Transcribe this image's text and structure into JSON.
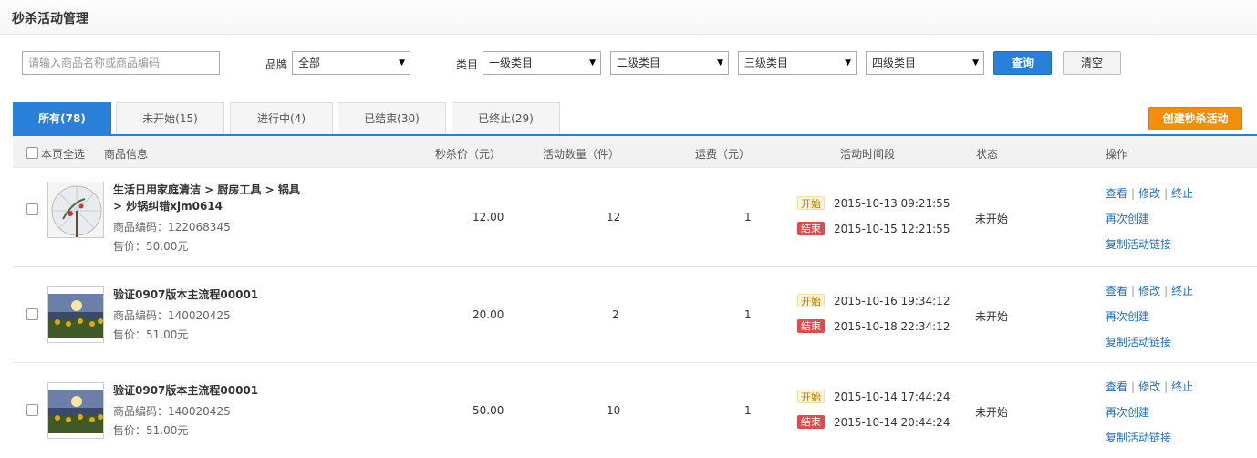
{
  "header": {
    "title": "秒杀活动管理"
  },
  "filters": {
    "search_placeholder": "请输入商品名称或商品编码",
    "brand_label": "品牌",
    "brand_value": "全部",
    "category_label": "类目",
    "cat1": "一级类目",
    "cat2": "二级类目",
    "cat3": "三级类目",
    "cat4": "四级类目",
    "query_label": "查询",
    "clear_label": "清空"
  },
  "tabs": [
    {
      "label": "所有(78)"
    },
    {
      "label": "未开始(15)"
    },
    {
      "label": "进行中(4)"
    },
    {
      "label": "已结束(30)"
    },
    {
      "label": "已终止(29)"
    }
  ],
  "create_label": "创建秒杀活动",
  "table": {
    "headers": {
      "select_all": "本页全选",
      "product": "商品信息",
      "price": "秒杀价（元）",
      "qty": "活动数量（件）",
      "freight": "运费（元）",
      "period": "活动时间段",
      "status": "状态",
      "ops": "操作"
    },
    "start_tag": "开始",
    "end_tag": "结束",
    "op_view": "查看",
    "op_edit": "修改",
    "op_stop": "终止",
    "op_recreate": "再次创建",
    "op_copy": "复制活动链接",
    "rows": [
      {
        "name": "生活日用家庭清洁 > 厨房工具 > 锅具 > 炒锅纠错xjm0614",
        "code": "商品编码：122068345",
        "sale_price": "售价：50.00元",
        "price": "12.00",
        "qty": "12",
        "freight": "1",
        "start_time": "2015-10-13 09:21:55",
        "end_time": "2015-10-15 12:21:55",
        "status": "未开始"
      },
      {
        "name": "验证0907版本主流程00001",
        "code": "商品编码：140020425",
        "sale_price": "售价：51.00元",
        "price": "20.00",
        "qty": "2",
        "freight": "1",
        "start_time": "2015-10-16 19:34:12",
        "end_time": "2015-10-18 22:34:12",
        "status": "未开始"
      },
      {
        "name": "验证0907版本主流程00001",
        "code": "商品编码：140020425",
        "sale_price": "售价：51.00元",
        "price": "50.00",
        "qty": "10",
        "freight": "1",
        "start_time": "2015-10-14 17:44:24",
        "end_time": "2015-10-14 20:44:24",
        "status": "未开始"
      }
    ]
  }
}
